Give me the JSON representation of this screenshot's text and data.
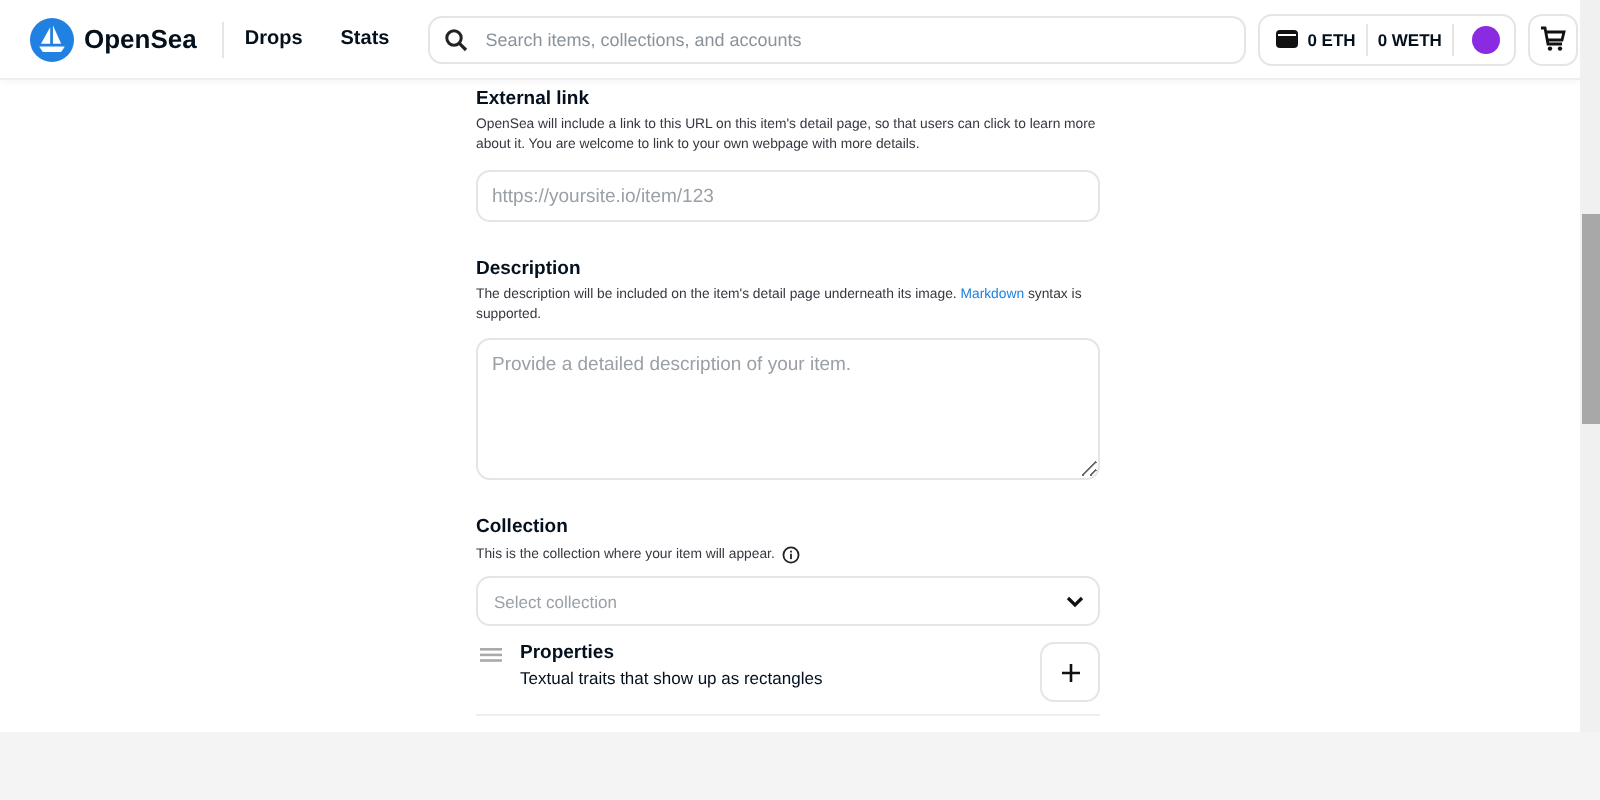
{
  "header": {
    "brand": "OpenSea",
    "nav": [
      {
        "label": "Drops"
      },
      {
        "label": "Stats"
      }
    ],
    "search": {
      "placeholder": "Search items, collections, and accounts"
    },
    "wallet": {
      "eth": "0 ETH",
      "weth": "0 WETH"
    }
  },
  "external_link": {
    "title": "External link",
    "help": "OpenSea will include a link to this URL on this item's detail page, so that users can click to learn more about it. You are welcome to link to your own webpage with more details.",
    "placeholder": "https://yoursite.io/item/123"
  },
  "description": {
    "title": "Description",
    "help_before": "The description will be included on the item's detail page underneath its image.",
    "link": "Markdown",
    "help_after": "syntax is supported.",
    "placeholder": "Provide a detailed description of your item."
  },
  "collection": {
    "title": "Collection",
    "help": "This is the collection where your item will appear.",
    "placeholder": "Select collection"
  },
  "properties": {
    "title": "Properties",
    "subtitle": "Textual traits that show up as rectangles"
  }
}
